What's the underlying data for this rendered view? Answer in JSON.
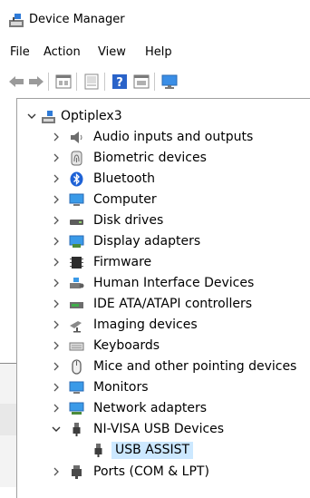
{
  "window": {
    "title": "Device Manager"
  },
  "menu": {
    "items": [
      "File",
      "Action",
      "View",
      "Help"
    ]
  },
  "tree": {
    "root": "Optiplex3",
    "categories": [
      "Audio inputs and outputs",
      "Biometric devices",
      "Bluetooth",
      "Computer",
      "Disk drives",
      "Display adapters",
      "Firmware",
      "Human Interface Devices",
      "IDE ATA/ATAPI controllers",
      "Imaging devices",
      "Keyboards",
      "Mice and other pointing devices",
      "Monitors",
      "Network adapters",
      "NI-VISA USB Devices"
    ],
    "child": "USB ASSIST",
    "last": "Ports (COM & LPT)"
  },
  "colors": {
    "accent_blue": "#1e90ff",
    "selection": "#cce8ff"
  }
}
